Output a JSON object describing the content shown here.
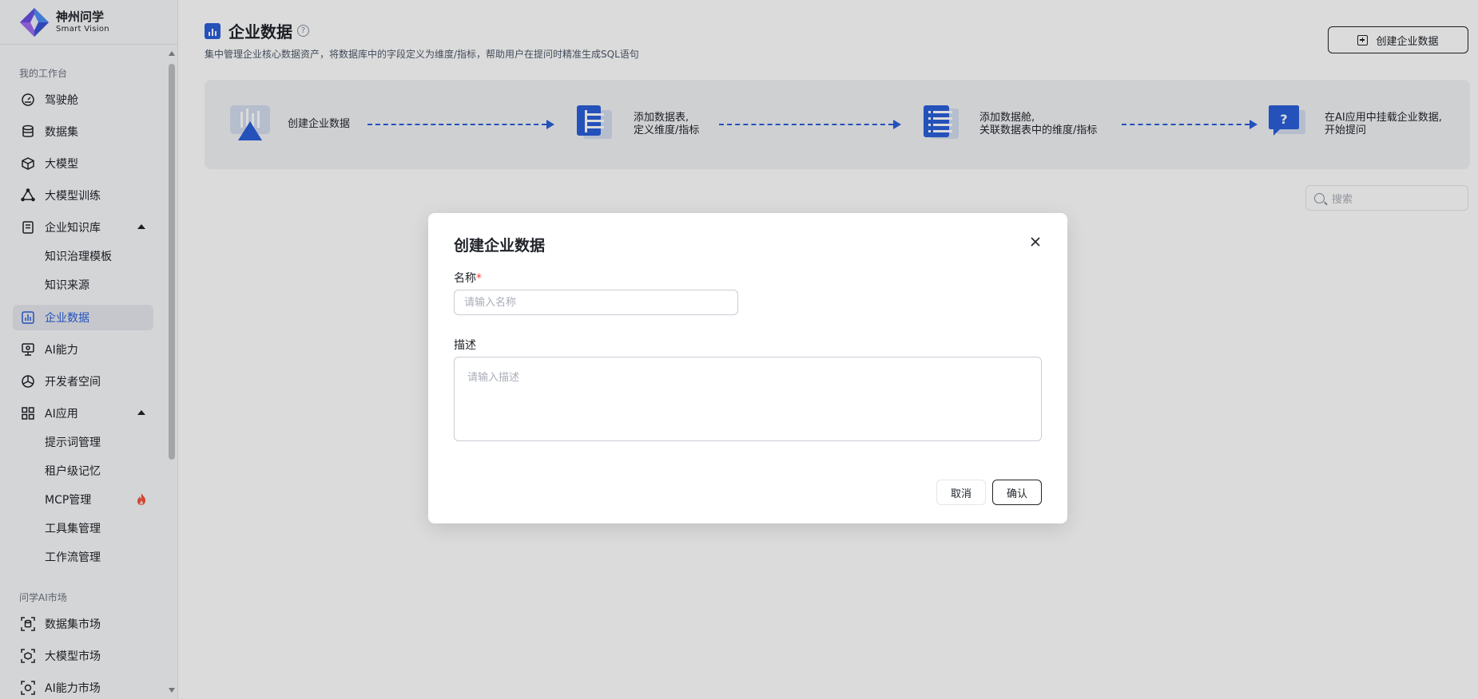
{
  "brand": {
    "name_cn": "神州问学",
    "name_en": "Smart Vision"
  },
  "sidebar": {
    "group1_title": "我的工作台",
    "items": [
      {
        "label": "驾驶舱",
        "icon": "dashboard-icon"
      },
      {
        "label": "数据集",
        "icon": "database-icon"
      },
      {
        "label": "大模型",
        "icon": "cube-icon"
      },
      {
        "label": "大模型训练",
        "icon": "training-icon"
      },
      {
        "label": "企业知识库",
        "icon": "book-icon",
        "expanded": true
      },
      {
        "label": "知识治理模板"
      },
      {
        "label": "知识来源"
      },
      {
        "label": "企业数据",
        "icon": "chart-icon",
        "active": true
      },
      {
        "label": "AI能力",
        "icon": "monitor-icon"
      },
      {
        "label": "开发者空间",
        "icon": "dev-space-icon"
      },
      {
        "label": "AI应用",
        "icon": "grid-icon",
        "expanded": true
      },
      {
        "label": "提示词管理"
      },
      {
        "label": "租户级记忆"
      },
      {
        "label": "MCP管理",
        "badge": "fire-icon"
      },
      {
        "label": "工具集管理"
      },
      {
        "label": "工作流管理"
      }
    ],
    "group2_title": "问学AI市场",
    "market_items": [
      {
        "label": "数据集市场",
        "icon": "dataset-market-icon"
      },
      {
        "label": "大模型市场",
        "icon": "model-market-icon"
      },
      {
        "label": "AI能力市场",
        "icon": "ai-market-icon"
      }
    ]
  },
  "header": {
    "title": "企业数据",
    "description": "集中管理企业核心数据资产，将数据库中的字段定义为维度/指标，帮助用户在提问时精准生成SQL语句",
    "create_button": "创建企业数据"
  },
  "steps": [
    {
      "line1": "创建企业数据",
      "line2": ""
    },
    {
      "line1": "添加数据表,",
      "line2": "定义维度/指标"
    },
    {
      "line1": "添加数据舱,",
      "line2": "关联数据表中的维度/指标"
    },
    {
      "line1": "在AI应用中挂载企业数据,",
      "line2": "开始提问"
    }
  ],
  "search": {
    "placeholder": "搜索"
  },
  "modal": {
    "title": "创建企业数据",
    "name_label": "名称",
    "name_required": "*",
    "name_placeholder": "请输入名称",
    "desc_label": "描述",
    "desc_placeholder": "请输入描述",
    "cancel": "取消",
    "confirm": "确认"
  },
  "colors": {
    "accent": "#2b5fd9",
    "required": "#f53f3f"
  }
}
